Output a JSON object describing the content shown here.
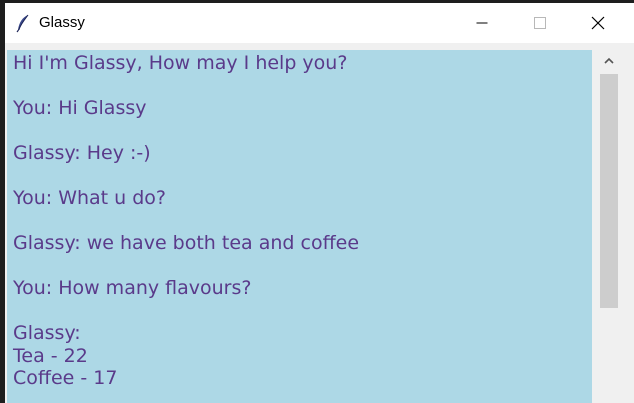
{
  "window": {
    "title": "Glassy",
    "app_icon": "feather-icon"
  },
  "titlebar_buttons": {
    "minimize_icon": "minimize-icon",
    "maximize_icon": "maximize-icon",
    "close_icon": "close-icon"
  },
  "chat": {
    "background_color": "#add8e6",
    "text_color": "#5a3a8a",
    "transcript": "Hi I'm Glassy, How may I help you?\n\nYou: Hi Glassy\n\nGlassy: Hey :-)\n\nYou: What u do?\n\nGlassy: we have both tea and coffee\n\nYou: How many flavours?\n\nGlassy:\nTea - 22\nCoffee - 17"
  },
  "scrollbar": {
    "up_arrow_icon": "chevron-up-icon"
  }
}
